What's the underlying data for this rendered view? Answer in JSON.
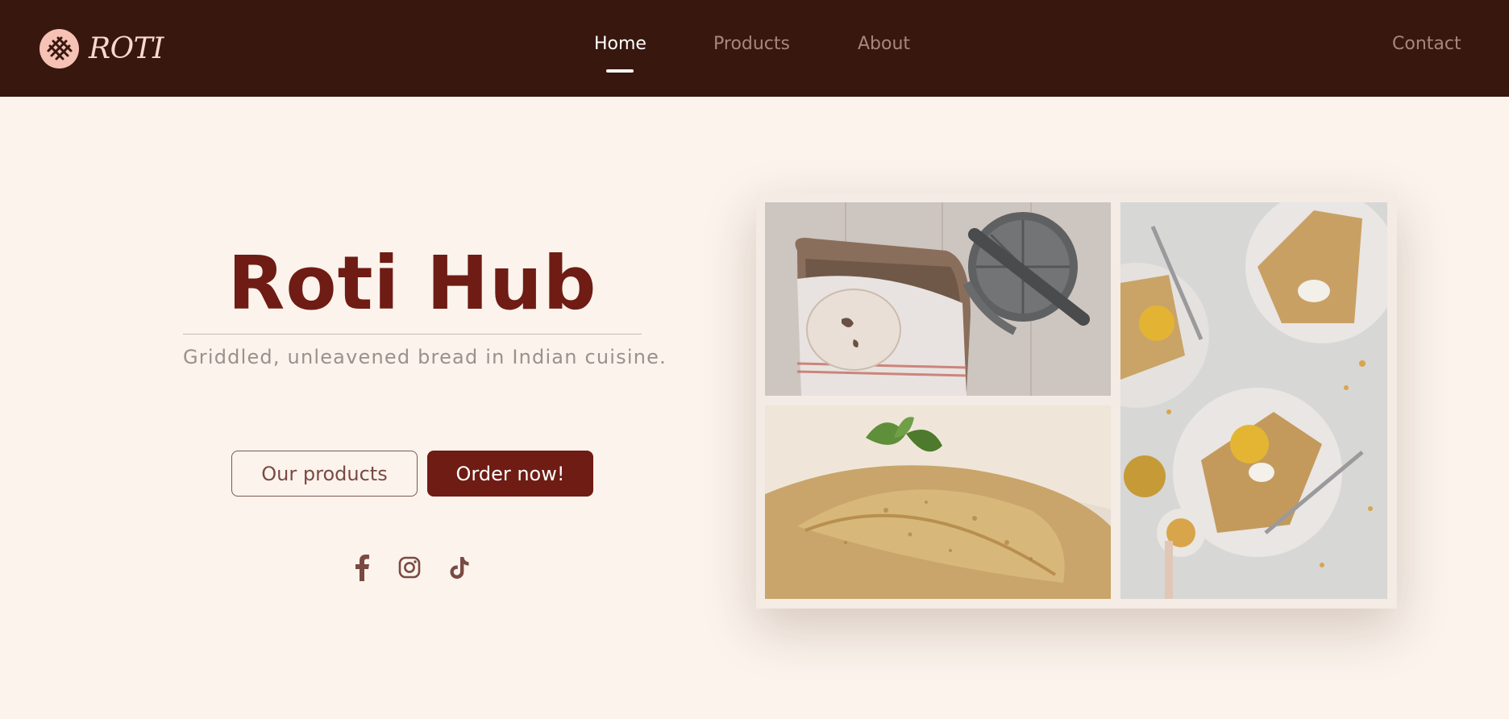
{
  "header": {
    "brand": "ROTI",
    "nav": {
      "home": "Home",
      "products": "Products",
      "about": "About",
      "contact": "Contact"
    },
    "active": "Home"
  },
  "hero": {
    "title": "Roti Hub",
    "subtitle": "Griddled, unleavened bread in Indian cuisine.",
    "buttons": {
      "products": "Our products",
      "order": "Order now!"
    }
  },
  "social": {
    "icons": [
      "facebook-icon",
      "instagram-icon",
      "tiktok-icon"
    ]
  },
  "colors": {
    "header_bg": "#38170f",
    "page_bg": "#fbf3ec",
    "accent": "#6e1c14",
    "logo_badge": "#f6c2b6"
  }
}
